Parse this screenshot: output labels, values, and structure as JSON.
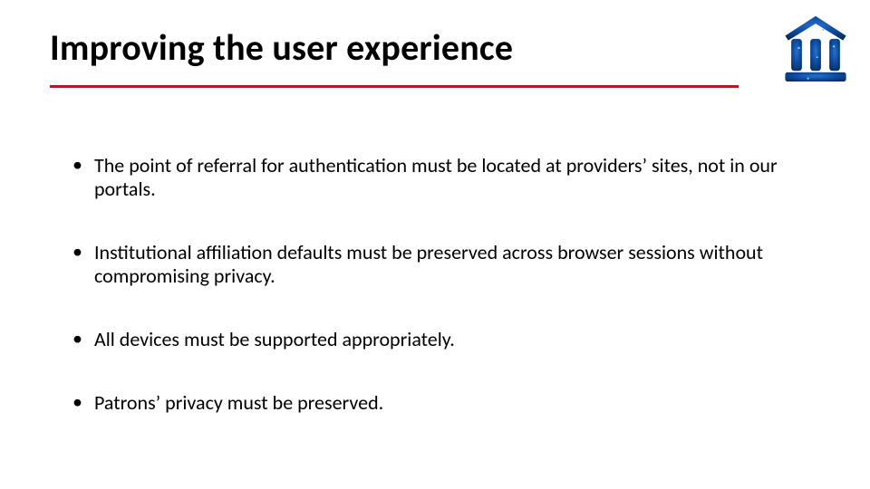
{
  "slide": {
    "title": "Improving the user experience",
    "bullets": [
      "The point of referral for authentication must be located at  providers’ sites, not in our portals.",
      "Institutional affiliation defaults must be preserved across browser sessions without compromising privacy.",
      "All devices must be supported appropriately.",
      "Patrons’ privacy must be preserved."
    ]
  },
  "colors": {
    "underline": "#b8181d"
  }
}
